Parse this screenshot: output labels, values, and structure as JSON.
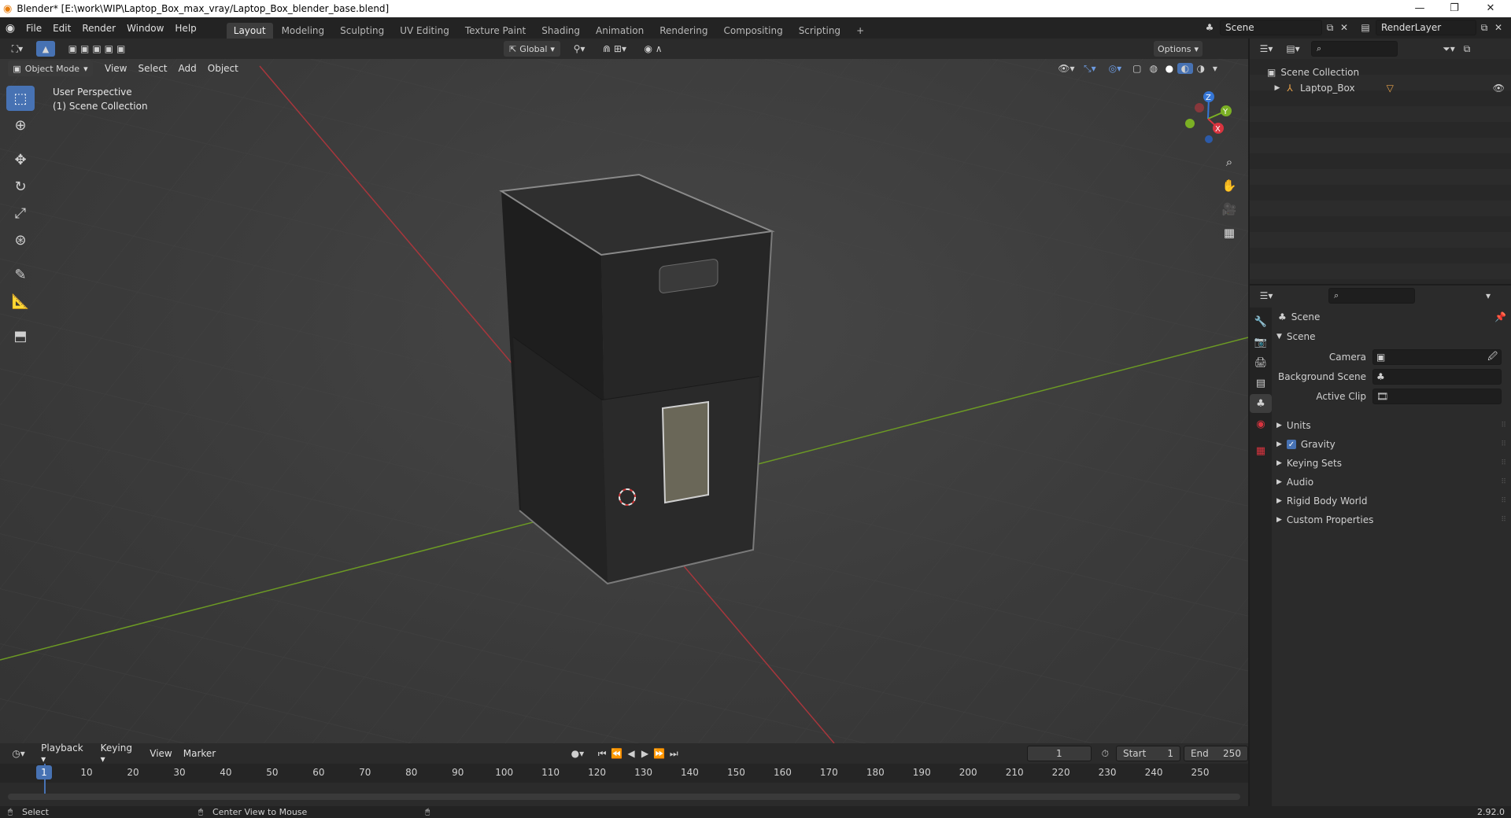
{
  "window": {
    "title": "Blender* [E:\\work\\WIP\\Laptop_Box_max_vray/Laptop_Box_blender_base.blend]",
    "minimize": "—",
    "maximize": "❐",
    "close": "✕"
  },
  "menubar": {
    "items": [
      "File",
      "Edit",
      "Render",
      "Window",
      "Help"
    ],
    "workspaces": [
      "Layout",
      "Modeling",
      "Sculpting",
      "UV Editing",
      "Texture Paint",
      "Shading",
      "Animation",
      "Rendering",
      "Compositing",
      "Scripting"
    ],
    "active_workspace": "Layout",
    "add_workspace": "+",
    "scene_name": "Scene",
    "view_layer_name": "RenderLayer"
  },
  "viewport_header": {
    "mode": "Object Mode",
    "menus": [
      "View",
      "Select",
      "Add",
      "Object"
    ],
    "orientation": "Global",
    "options_label": "Options"
  },
  "viewport": {
    "perspective_label": "User Perspective",
    "collection_label": "(1) Scene Collection",
    "gizmo_axes": [
      "Z",
      "Y",
      "X"
    ],
    "colors": {
      "x_axis": "#d9343f",
      "y_axis": "#7bb024",
      "z_axis": "#3576d6",
      "selection": "#4772b3"
    }
  },
  "toolbar": {
    "tools": [
      "select-box-icon",
      "cursor-icon",
      "move-icon",
      "rotate-icon",
      "scale-icon",
      "transform-icon",
      "annotate-icon",
      "measure-icon",
      "add-cube-icon"
    ]
  },
  "outliner": {
    "root": "Scene Collection",
    "items": [
      {
        "name": "Laptop_Box"
      }
    ]
  },
  "properties": {
    "context": "Scene",
    "section_title": "Scene",
    "fields": [
      {
        "label": "Camera",
        "value": ""
      },
      {
        "label": "Background Scene",
        "value": ""
      },
      {
        "label": "Active Clip",
        "value": ""
      }
    ],
    "panels": [
      "Units",
      "Gravity",
      "Keying Sets",
      "Audio",
      "Rigid Body World",
      "Custom Properties"
    ],
    "gravity_checked": true
  },
  "timeline": {
    "menus": [
      "Playback",
      "Keying",
      "View",
      "Marker"
    ],
    "current_frame": "1",
    "start_label": "Start",
    "start_value": "1",
    "end_label": "End",
    "end_value": "250",
    "ticks": [
      "1",
      "10",
      "20",
      "30",
      "40",
      "50",
      "60",
      "70",
      "80",
      "90",
      "100",
      "110",
      "120",
      "130",
      "140",
      "150",
      "160",
      "170",
      "180",
      "190",
      "200",
      "210",
      "220",
      "230",
      "240",
      "250"
    ]
  },
  "statusbar": {
    "select_label": "Select",
    "center_label": "Center View to Mouse",
    "version": "2.92.0"
  }
}
